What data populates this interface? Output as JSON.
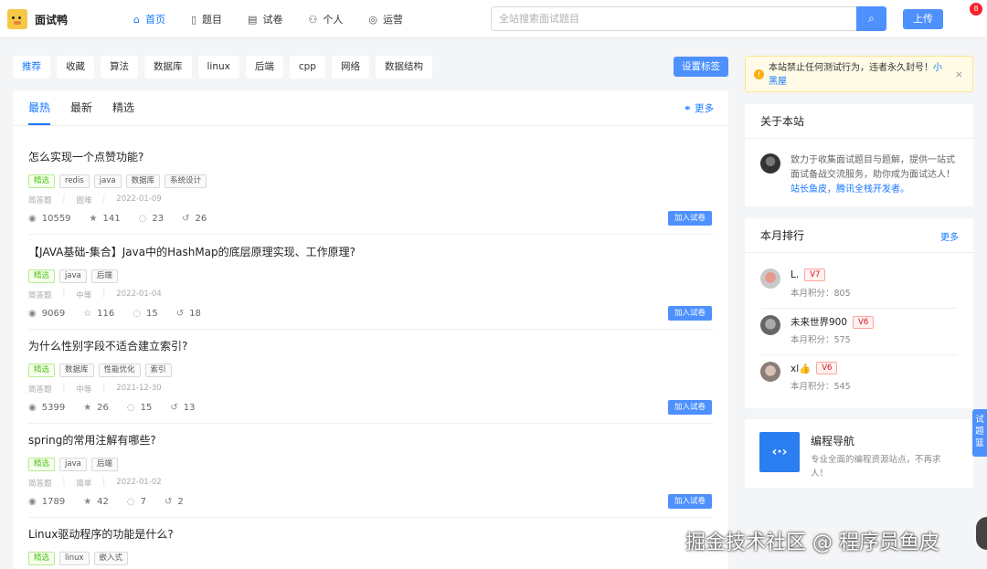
{
  "header": {
    "logo_text": "面试鸭",
    "nav": [
      {
        "label": "首页",
        "icon": "home-icon"
      },
      {
        "label": "题目",
        "icon": "file-icon"
      },
      {
        "label": "试卷",
        "icon": "paper-icon"
      },
      {
        "label": "个人",
        "icon": "user-icon"
      },
      {
        "label": "运营",
        "icon": "shield-icon"
      }
    ],
    "search_placeholder": "全站搜索面试题目",
    "upload_label": "上传",
    "badge_count": "8"
  },
  "tags": [
    "推荐",
    "收藏",
    "算法",
    "数据库",
    "linux",
    "后端",
    "cpp",
    "网络",
    "数据结构"
  ],
  "set_tag_label": "设置标签",
  "tabs": [
    "最热",
    "最新",
    "精选"
  ],
  "more_label": "更多",
  "questions": [
    {
      "title": "怎么实现一个点赞功能?",
      "tags": [
        "精选",
        "redis",
        "java",
        "数据库",
        "系统设计"
      ],
      "type": "简答题",
      "difficulty": "困难",
      "date": "2022-01-09",
      "views": "10559",
      "stars": "141",
      "comments": "23",
      "answers": "26"
    },
    {
      "title": "【JAVA基础-集合】Java中的HashMap的底层原理实现、工作原理?",
      "tags": [
        "精选",
        "java",
        "后端"
      ],
      "type": "简答题",
      "difficulty": "中等",
      "date": "2022-01-04",
      "views": "9069",
      "stars": "116",
      "comments": "15",
      "answers": "18"
    },
    {
      "title": "为什么性别字段不适合建立索引?",
      "tags": [
        "精选",
        "数据库",
        "性能优化",
        "索引"
      ],
      "type": "简答题",
      "difficulty": "中等",
      "date": "2021-12-30",
      "views": "5399",
      "stars": "26",
      "comments": "15",
      "answers": "13"
    },
    {
      "title": "spring的常用注解有哪些?",
      "tags": [
        "精选",
        "java",
        "后端"
      ],
      "type": "简答题",
      "difficulty": "简单",
      "date": "2022-01-02",
      "views": "1789",
      "stars": "42",
      "comments": "7",
      "answers": "2"
    },
    {
      "title": "Linux驱动程序的功能是什么?",
      "tags": [
        "精选",
        "linux",
        "嵌入式"
      ]
    }
  ],
  "add_to_paper_label": "加入试卷",
  "notice": {
    "text": "本站禁止任何测试行为，违者永久封号！",
    "link": "小黑屋"
  },
  "about": {
    "title": "关于本站",
    "text": "致力于收集面试题目与题解，提供一站式面试备战交流服务，助你成为面试达人！",
    "links": [
      "站长鱼皮",
      "腾讯全栈开发者。"
    ]
  },
  "ranking": {
    "title": "本月排行",
    "more": "更多",
    "score_label": "本月积分：",
    "users": [
      {
        "name": "L.",
        "level": "V7",
        "score": "805"
      },
      {
        "name": "未来世界900",
        "level": "V6",
        "score": "575"
      },
      {
        "name": "xl👍",
        "level": "V6",
        "score": "545"
      }
    ]
  },
  "nav_card": {
    "title": "编程导航",
    "desc": "专业全面的编程资源站点，不再求人！"
  },
  "side_tab": "试题篮",
  "watermark": "掘金技术社区 @ 程序员鱼皮"
}
